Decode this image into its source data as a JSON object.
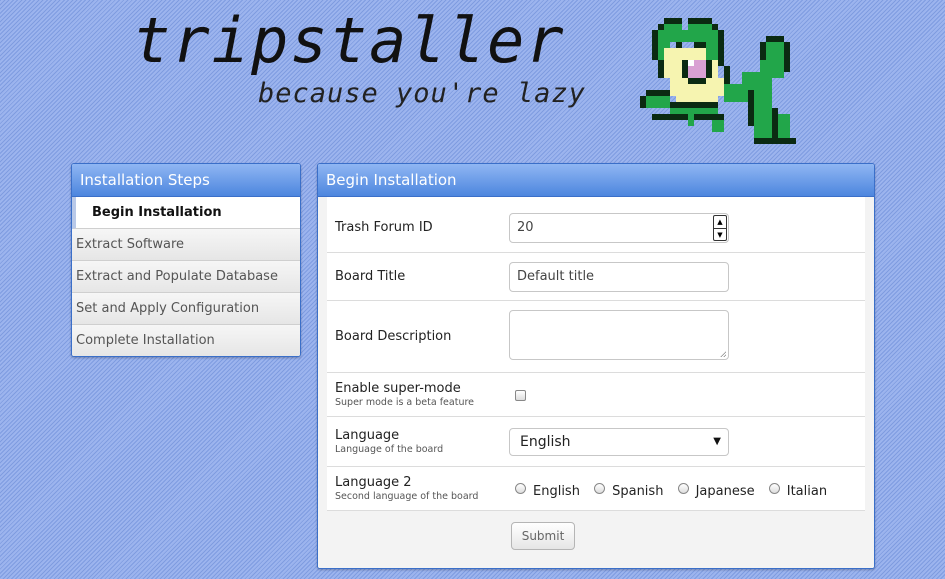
{
  "header": {
    "title": "tripstaller",
    "subtitle": "because you're lazy",
    "mascot_icon": "pixel-frog"
  },
  "sidebar": {
    "heading": "Installation Steps",
    "items": [
      {
        "label": "Begin Installation",
        "active": true
      },
      {
        "label": "Extract Software",
        "active": false
      },
      {
        "label": "Extract and Populate Database",
        "active": false
      },
      {
        "label": "Set and Apply Configuration",
        "active": false
      },
      {
        "label": "Complete Installation",
        "active": false
      }
    ]
  },
  "main": {
    "heading": "Begin Installation",
    "fields": {
      "trash_forum_id": {
        "label": "Trash Forum ID",
        "value": "20"
      },
      "board_title": {
        "label": "Board Title",
        "value": "Default title"
      },
      "board_description": {
        "label": "Board Description",
        "value": ""
      },
      "super_mode": {
        "label": "Enable super-mode",
        "help": "Super mode is a beta feature",
        "checked": false
      },
      "language": {
        "label": "Language",
        "help": "Language of the board",
        "selected": "English"
      },
      "language2": {
        "label": "Language 2",
        "help": "Second language of the board",
        "options": [
          "English",
          "Spanish",
          "Japanese",
          "Italian"
        ]
      }
    },
    "submit_label": "Submit"
  },
  "colors": {
    "accent": "#4d86de",
    "background": "#8aa6e6"
  }
}
